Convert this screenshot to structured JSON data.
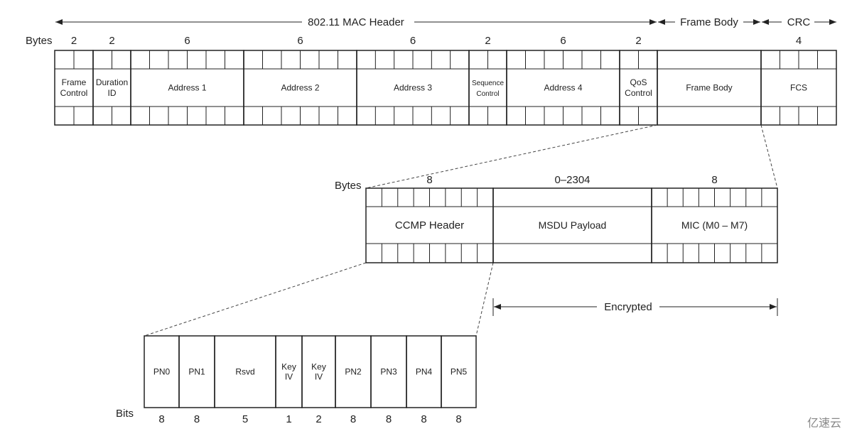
{
  "top": {
    "mac_header_label": "802.11 MAC Header",
    "frame_body_label": "Frame Body",
    "crc_label": "CRC",
    "bytes_label": "Bytes",
    "fields": [
      {
        "name": [
          "Frame",
          "Control"
        ],
        "bytes": "2",
        "cells": 2
      },
      {
        "name": [
          "Duration",
          "ID"
        ],
        "bytes": "2",
        "cells": 2
      },
      {
        "name": [
          "Address 1"
        ],
        "bytes": "6",
        "cells": 6
      },
      {
        "name": [
          "Address 2"
        ],
        "bytes": "6",
        "cells": 6
      },
      {
        "name": [
          "Address 3"
        ],
        "bytes": "6",
        "cells": 6
      },
      {
        "name": [
          "Sequence",
          "Control"
        ],
        "bytes": "2",
        "cells": 2,
        "small": true
      },
      {
        "name": [
          "Address 4"
        ],
        "bytes": "6",
        "cells": 6
      },
      {
        "name": [
          "QoS",
          "Control"
        ],
        "bytes": "2",
        "cells": 2
      },
      {
        "name": [
          "Frame Body"
        ],
        "bytes": "",
        "cells": 1
      },
      {
        "name": [
          "FCS"
        ],
        "bytes": "4",
        "cells": 4
      }
    ]
  },
  "middle": {
    "bytes_label": "Bytes",
    "fields": [
      {
        "name": "CCMP Header",
        "bytes": "8",
        "cells": 8
      },
      {
        "name": "MSDU Payload",
        "bytes": "0–2304",
        "cells": 1
      },
      {
        "name": "MIC (M0 – M7)",
        "bytes": "8",
        "cells": 8
      }
    ],
    "encrypted_label": "Encrypted"
  },
  "bottom": {
    "bits_label": "Bits",
    "fields": [
      {
        "name": [
          "PN0"
        ],
        "bits": "8"
      },
      {
        "name": [
          "PN1"
        ],
        "bits": "8"
      },
      {
        "name": [
          "Rsvd"
        ],
        "bits": "5"
      },
      {
        "name": [
          "Key",
          "IV"
        ],
        "bits": "1"
      },
      {
        "name": [
          "Key",
          "IV"
        ],
        "bits": "2"
      },
      {
        "name": [
          "PN2"
        ],
        "bits": "8"
      },
      {
        "name": [
          "PN3"
        ],
        "bits": "8"
      },
      {
        "name": [
          "PN4"
        ],
        "bits": "8"
      },
      {
        "name": [
          "PN5"
        ],
        "bits": "8"
      }
    ]
  },
  "watermark": "亿速云",
  "colors": {
    "line": "#222222",
    "watermark": "#888888"
  }
}
